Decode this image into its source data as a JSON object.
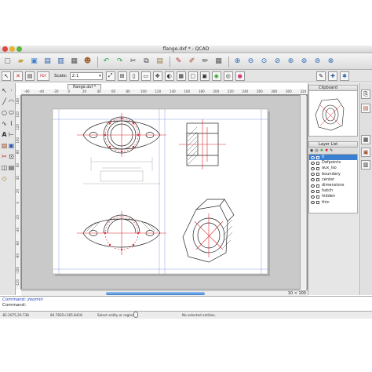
{
  "window": {
    "title": "flange.dxf * - QCAD",
    "tab_title": "flange.dxf *"
  },
  "toolbar": {
    "scale_label": "Scale:",
    "scale_value": "2:1",
    "pdf_label": "PDF"
  },
  "ruler": {
    "h_ticks": [
      "-60",
      "-40",
      "-20",
      "0",
      "20",
      "40",
      "60",
      "80",
      "100",
      "120",
      "140",
      "160",
      "180",
      "200",
      "220",
      "240",
      "260",
      "280",
      "300",
      "320"
    ],
    "v_ticks": [
      "160",
      "140",
      "120",
      "100",
      "80",
      "60",
      "40",
      "20",
      "0",
      "-20",
      "-40",
      "-60",
      "-80",
      "-100",
      "-120"
    ]
  },
  "scroll": {
    "zoom_readout": "10 < 100"
  },
  "clipboard": {
    "title": "Clipboard"
  },
  "layers": {
    "title": "Layer List",
    "items": [
      {
        "name": "0",
        "selected": true
      },
      {
        "name": "Defpoints",
        "selected": false
      },
      {
        "name": "aux_iso",
        "selected": false
      },
      {
        "name": "boundary",
        "selected": false
      },
      {
        "name": "center",
        "selected": false
      },
      {
        "name": "dimensions",
        "selected": false
      },
      {
        "name": "hatch",
        "selected": false
      },
      {
        "name": "hidden",
        "selected": false
      },
      {
        "name": "thin",
        "selected": false
      }
    ]
  },
  "command": {
    "history": "Command: zoomin",
    "prompt": "Command:"
  },
  "status": {
    "abs_coord": "-82.2075,20.738",
    "rel_coord": "84.7835<165.8418",
    "hint": "Select entity or region",
    "selection": "No selected entities."
  },
  "colors": {
    "accent": "#3b7fd1",
    "red_line": "#e0262b",
    "layer_selected": "#3b7fd1",
    "command_blue": "#1f3fbf"
  },
  "icons": {
    "window_icon": "qcad-drawing-icon",
    "new": "new-file-icon",
    "open": "open-folder-icon",
    "save": "save-disk-icon",
    "undo": "undo-arrow-icon",
    "redo": "redo-arrow-icon",
    "zoom": "zoom-magnifier-icon"
  }
}
